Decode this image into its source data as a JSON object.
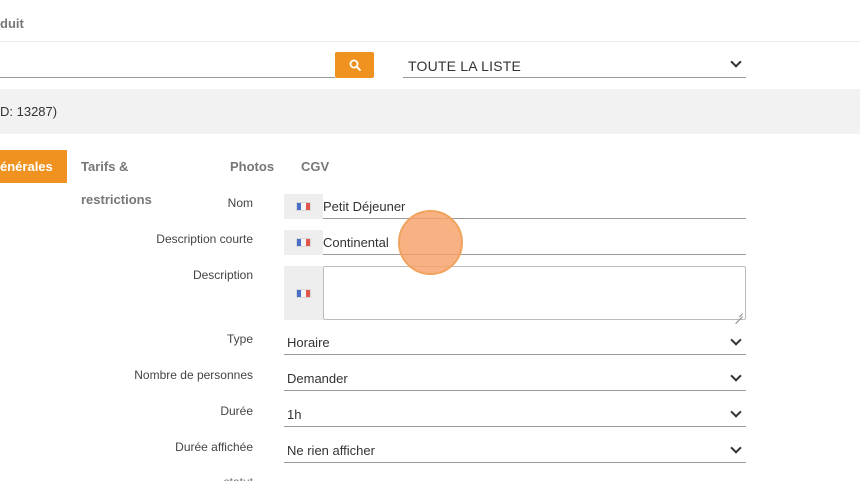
{
  "header": {
    "title": "duit"
  },
  "search": {
    "value": "",
    "button": "search-icon"
  },
  "list_filter": {
    "selected": "TOUTE LA LISTE"
  },
  "product": {
    "id_label": "D: 13287)"
  },
  "tabs": [
    {
      "label": "énérales",
      "active": true
    },
    {
      "label": "Tarifs & restrictions",
      "active": false
    },
    {
      "label": "Photos",
      "active": false
    },
    {
      "label": "CGV",
      "active": false
    }
  ],
  "form": {
    "nom": {
      "label": "Nom",
      "value": "Petit Déjeuner"
    },
    "description_courte": {
      "label": "Description courte",
      "value": "Continental"
    },
    "description": {
      "label": "Description",
      "value": ""
    },
    "type": {
      "label": "Type",
      "value": "Horaire"
    },
    "nombre_personnes": {
      "label": "Nombre de personnes",
      "value": "Demander"
    },
    "duree": {
      "label": "Durée",
      "value": "1h"
    },
    "duree_affichee": {
      "label": "Durée affichée",
      "value": "Ne rien afficher"
    },
    "statut": {
      "label": "statut",
      "value": ""
    }
  },
  "colors": {
    "accent": "#f0921f",
    "band": "#f2f2f2",
    "flag_box": "#eeeeee"
  }
}
